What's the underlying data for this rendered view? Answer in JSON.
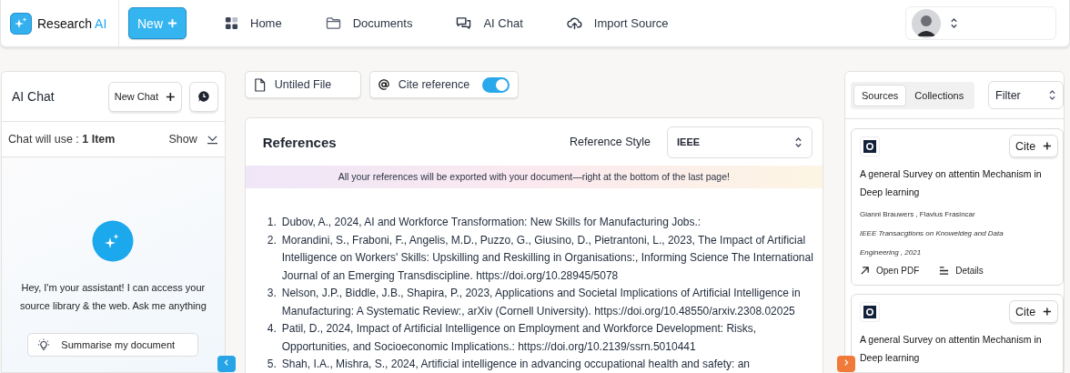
{
  "app": {
    "name": "Research",
    "accent": "AI"
  },
  "new_button": {
    "label": "New"
  },
  "nav": [
    {
      "label": "Home",
      "kind": "grid"
    },
    {
      "label": "Documents",
      "kind": "folder"
    },
    {
      "label": "AI Chat",
      "kind": "chat"
    },
    {
      "label": "Import Source",
      "kind": "upload"
    }
  ],
  "chat_panel": {
    "title": "AI Chat",
    "new_chat": "New Chat",
    "usage": "Chat will use : **1 Item**",
    "show": "Show",
    "greeting": "Hey, I'm your assistant! I can access your source library & the web. Ask me anything",
    "suggestions": [
      "Summarise my document"
    ]
  },
  "file": {
    "name": "Untiled File"
  },
  "cite_toggle": {
    "label": "Cite reference",
    "on": true
  },
  "references": {
    "title": "References",
    "style_label": "Reference Style",
    "style_value": "IEEE",
    "notice": "All your references will be exported with your document—right at the bottom of the last page!",
    "items": [
      {
        "number": "1.",
        "text": "Dubov, A., 2024, AI and Workforce Transformation: New Skills for Manufacturing Jobs.:"
      },
      {
        "number": "2.",
        "text": "Morandini, S., Fraboni, F., Angelis, M.D., Puzzo, G., Giusino, D., Pietrantoni, L., 2023, The Impact of Artificial Intelligence on Workers' Skills: Upskilling and Reskilling in Organisations:, Informing Science The International Journal of an Emerging Transdiscipline. https://doi.org/10.28945/5078"
      },
      {
        "number": "3.",
        "text": "Nelson, J.P., Biddle, J.B., Shapira, P., 2023, Applications and Societal Implications of Artificial Intelligence in Manufacturing: A Systematic Review:, arXiv (Cornell University). https://doi.org/10.48550/arxiv.2308.02025"
      },
      {
        "number": "4.",
        "text": "Patil, D., 2024, Impact of Artificial Intelligence on Employment and Workforce Development: Risks, Opportunities, and Socioeconomic Implications.: https://doi.org/10.2139/ssrn.5010441"
      },
      {
        "number": "5.",
        "text": "Shah, I.A., Mishra, S., 2024, Artificial intelligence in advancing occupational health and safety: an"
      }
    ]
  },
  "sources": {
    "tabs": [
      {
        "label": "Sources",
        "selected": true
      },
      {
        "label": "Collections",
        "selected": false
      }
    ],
    "filter": "Filter",
    "cards": [
      {
        "cite": "Cite",
        "title": "A general Survey on attentin Mechanism in Deep learning",
        "authors": "Gianni Brauwers , Flavius Frasincar",
        "journal": "IEEE Transacgtions on Knoweldeg and Data Engineering , 2021",
        "open_pdf": "Open PDF",
        "details": "Details"
      },
      {
        "cite": "Cite",
        "title": "A general Survey on attentin Mechanism in Deep learning"
      }
    ]
  }
}
